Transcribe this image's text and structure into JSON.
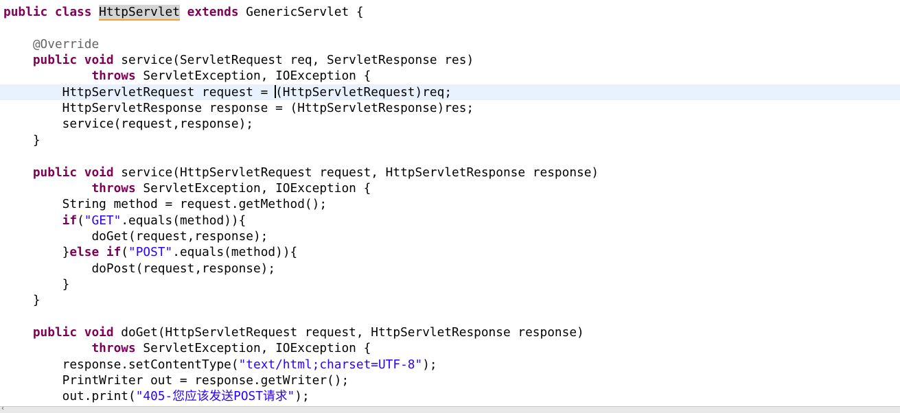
{
  "editor": {
    "current_line_index": 5,
    "cursor_line_index": 5,
    "highlighted_class_name": "HttpServlet",
    "lines": [
      [
        {
          "t": "public class ",
          "k": "kw"
        },
        {
          "t": "HttpServlet",
          "k": "hl"
        },
        {
          "t": " "
        },
        {
          "t": "extends",
          "k": "kw"
        },
        {
          "t": " GenericServlet {"
        }
      ],
      [],
      [
        {
          "t": "    "
        },
        {
          "t": "@Override",
          "k": "ann"
        }
      ],
      [
        {
          "t": "    "
        },
        {
          "t": "public void",
          "k": "kw"
        },
        {
          "t": " service(ServletRequest req, ServletResponse res)"
        }
      ],
      [
        {
          "t": "            "
        },
        {
          "t": "throws",
          "k": "kw"
        },
        {
          "t": " ServletException, IOException {"
        }
      ],
      [
        {
          "t": "        HttpServletRequest request = "
        },
        {
          "t": "",
          "k": "cursor"
        },
        {
          "t": "(HttpServletRequest)req;"
        }
      ],
      [
        {
          "t": "        HttpServletResponse response = (HttpServletResponse)res;"
        }
      ],
      [
        {
          "t": "        service(request,response);"
        }
      ],
      [
        {
          "t": "    }"
        }
      ],
      [],
      [
        {
          "t": "    "
        },
        {
          "t": "public void",
          "k": "kw"
        },
        {
          "t": " service(HttpServletRequest request, HttpServletResponse response)"
        }
      ],
      [
        {
          "t": "            "
        },
        {
          "t": "throws",
          "k": "kw"
        },
        {
          "t": " ServletException, IOException {"
        }
      ],
      [
        {
          "t": "        String method = request.getMethod();"
        }
      ],
      [
        {
          "t": "        "
        },
        {
          "t": "if",
          "k": "kw"
        },
        {
          "t": "("
        },
        {
          "t": "\"GET\"",
          "k": "str"
        },
        {
          "t": ".equals(method)){"
        }
      ],
      [
        {
          "t": "            doGet(request,response);"
        }
      ],
      [
        {
          "t": "        }"
        },
        {
          "t": "else if",
          "k": "kw"
        },
        {
          "t": "("
        },
        {
          "t": "\"POST\"",
          "k": "str"
        },
        {
          "t": ".equals(method)){"
        }
      ],
      [
        {
          "t": "            doPost(request,response);"
        }
      ],
      [
        {
          "t": "        }"
        }
      ],
      [
        {
          "t": "    }"
        }
      ],
      [],
      [
        {
          "t": "    "
        },
        {
          "t": "public void",
          "k": "kw"
        },
        {
          "t": " doGet(HttpServletRequest request, HttpServletResponse response)"
        }
      ],
      [
        {
          "t": "            "
        },
        {
          "t": "throws",
          "k": "kw"
        },
        {
          "t": " ServletException, IOException {"
        }
      ],
      [
        {
          "t": "        response.setContentType("
        },
        {
          "t": "\"text/html;charset=UTF-8\"",
          "k": "str"
        },
        {
          "t": ");"
        }
      ],
      [
        {
          "t": "        PrintWriter out = response.getWriter();"
        }
      ],
      [
        {
          "t": "        out.print("
        },
        {
          "t": "\"405-您应该发送POST请求\"",
          "k": "str"
        },
        {
          "t": ");"
        }
      ]
    ]
  },
  "colors": {
    "keyword": "#7f0055",
    "string": "#2a00ff",
    "annotation": "#646464",
    "current_line": "#e8f2fe",
    "occurrence_highlight": "#d4d4d4"
  },
  "icons": {
    "scroll_left": "chevron-left-icon"
  },
  "scrollbar": {
    "left_arrow": "‹"
  }
}
